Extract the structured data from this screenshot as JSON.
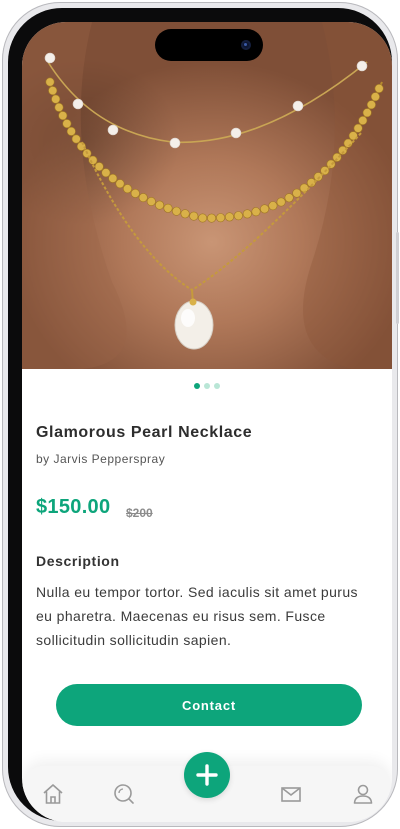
{
  "product": {
    "title": "Glamorous Pearl Necklace",
    "author": "by Jarvis Pepperspray",
    "price": "$150.00",
    "old_price": "$200",
    "description_heading": "Description",
    "description": "Nulla eu tempor tortor. Sed iaculis sit amet purus eu pharetra. Maecenas eu risus sem. Fusce sollicitudin sollicitudin sapien.",
    "image_slides": 3,
    "active_slide": 1
  },
  "contact_label": "Contact",
  "tabbar": {
    "items": [
      {
        "icon": "home-icon"
      },
      {
        "icon": "search-icon"
      },
      {
        "icon": "add-icon"
      },
      {
        "icon": "mail-icon"
      },
      {
        "icon": "user-icon"
      }
    ]
  },
  "colors": {
    "accent": "#0da57b",
    "dot_inactive": "#b9e6d6"
  }
}
